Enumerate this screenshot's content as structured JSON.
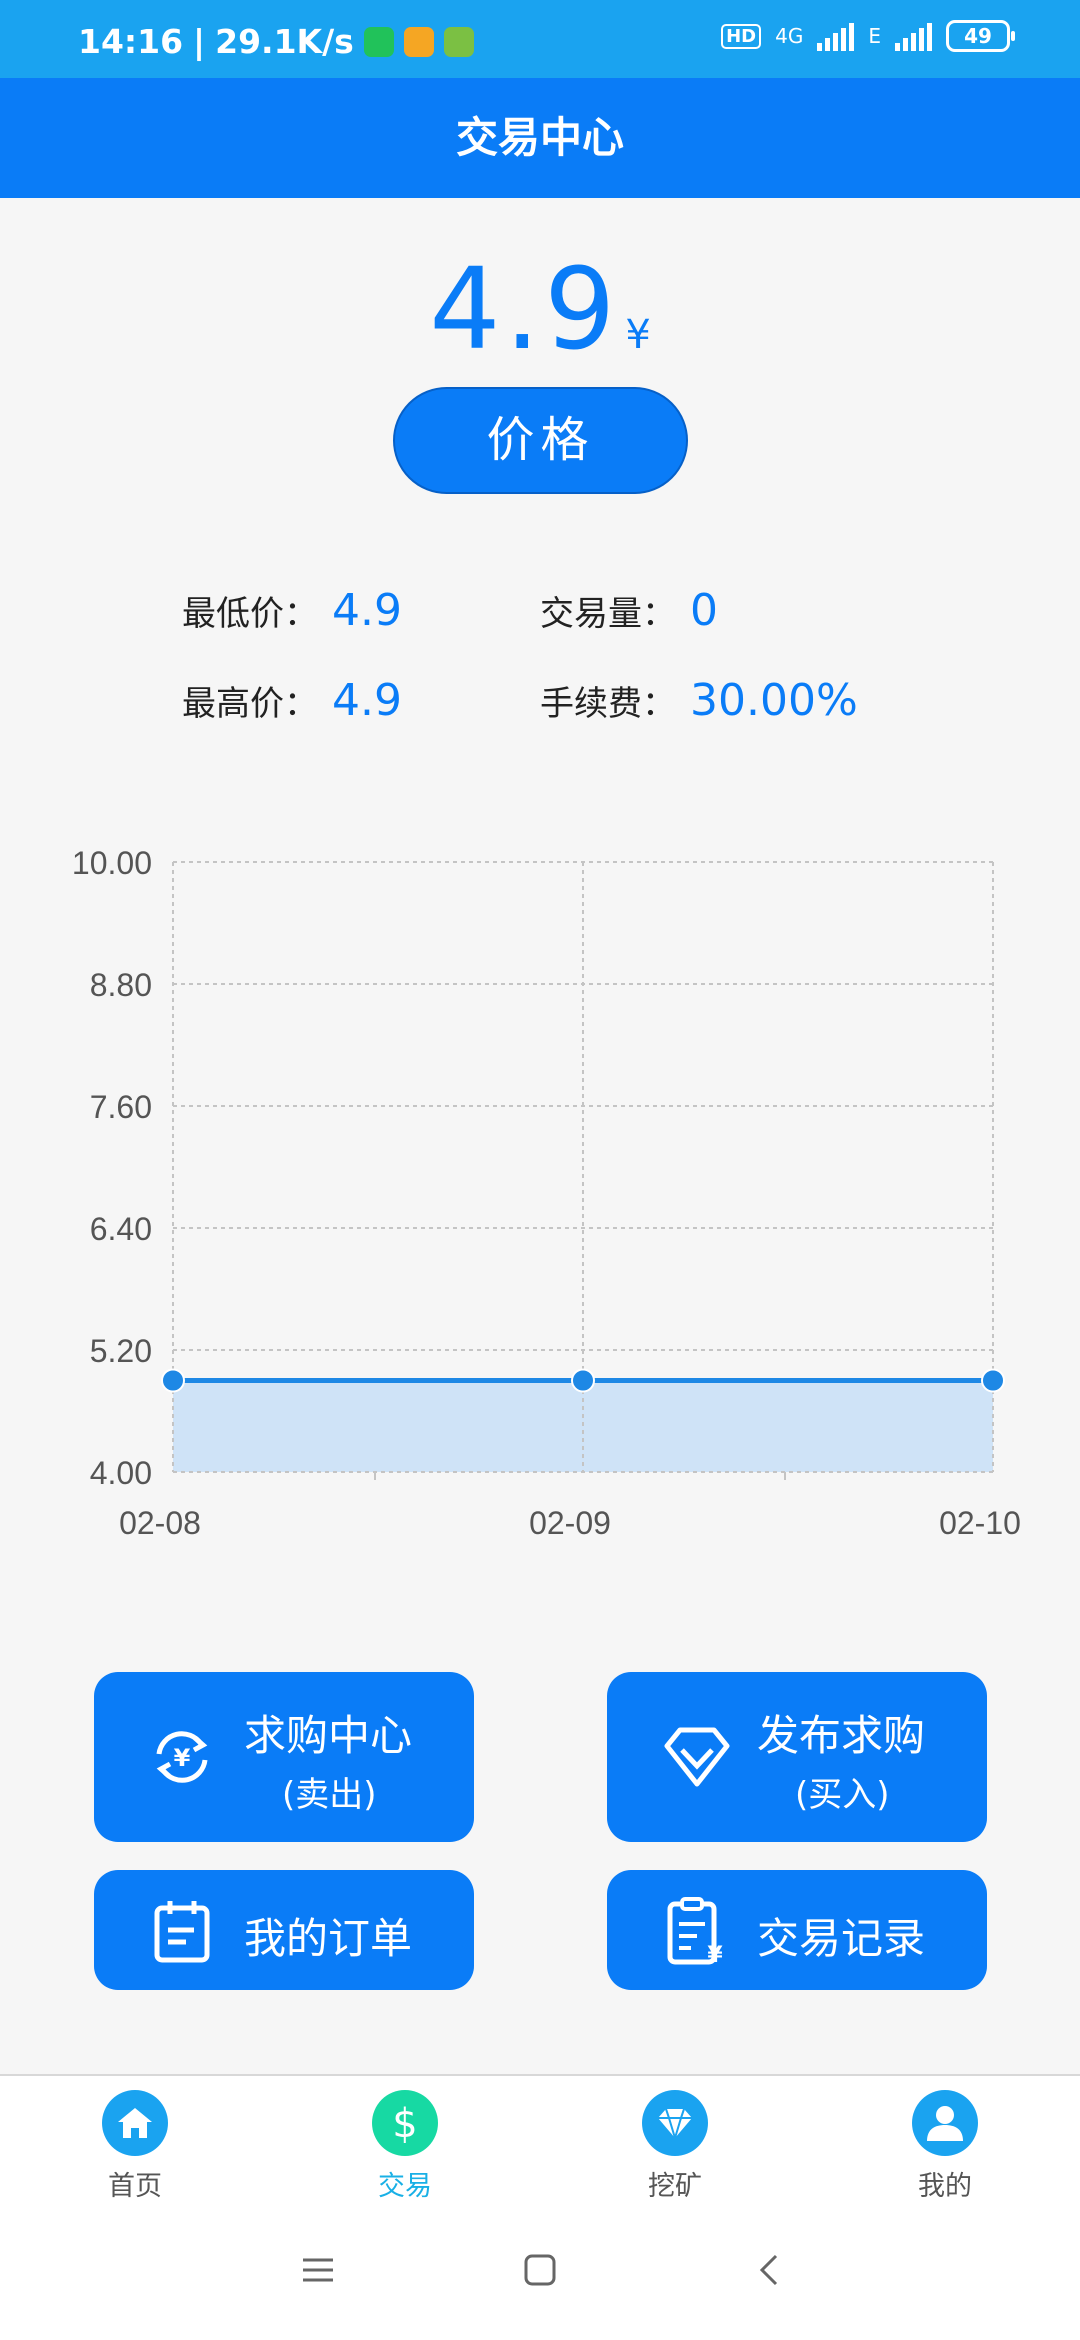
{
  "status_bar": {
    "time": "14:16",
    "speed": "29.1K/s",
    "hd": "HD",
    "net": "4G",
    "net2": "E",
    "battery": "49"
  },
  "header": {
    "title": "交易中心"
  },
  "price": {
    "value": "4.9",
    "unit": "¥",
    "button_label": "价格"
  },
  "stats": {
    "min_label": "最低价：",
    "min_value": "4.9",
    "volume_label": "交易量：",
    "volume_value": "0",
    "max_label": "最高价：",
    "max_value": "4.9",
    "fee_label": "手续费：",
    "fee_value": "30.00%"
  },
  "chart_data": {
    "type": "area",
    "categories": [
      "02-08",
      "02-09",
      "02-10"
    ],
    "series": [
      {
        "values": [
          4.9,
          4.9,
          4.9
        ]
      }
    ],
    "yticks": [
      "10.00",
      "8.80",
      "7.60",
      "6.40",
      "5.20",
      "4.00"
    ],
    "ylim": [
      4.0,
      10.0
    ],
    "grid": true,
    "line_color": "#1e88e5",
    "fill_color": "#cfe3f7"
  },
  "actions": {
    "buy_center": {
      "label": "求购中心",
      "sub": "(卖出)"
    },
    "publish_buy": {
      "label": "发布求购",
      "sub": "(买入)"
    },
    "my_orders": {
      "label": "我的订单"
    },
    "trade_records": {
      "label": "交易记录"
    }
  },
  "nav": {
    "home": "首页",
    "trade": "交易",
    "mining": "挖矿",
    "mine": "我的"
  },
  "colors": {
    "primary": "#0a7cf7",
    "status_bar": "#1aa3f0",
    "nav_active": "#19b0e6",
    "nav_trade": "#17d9a3"
  }
}
